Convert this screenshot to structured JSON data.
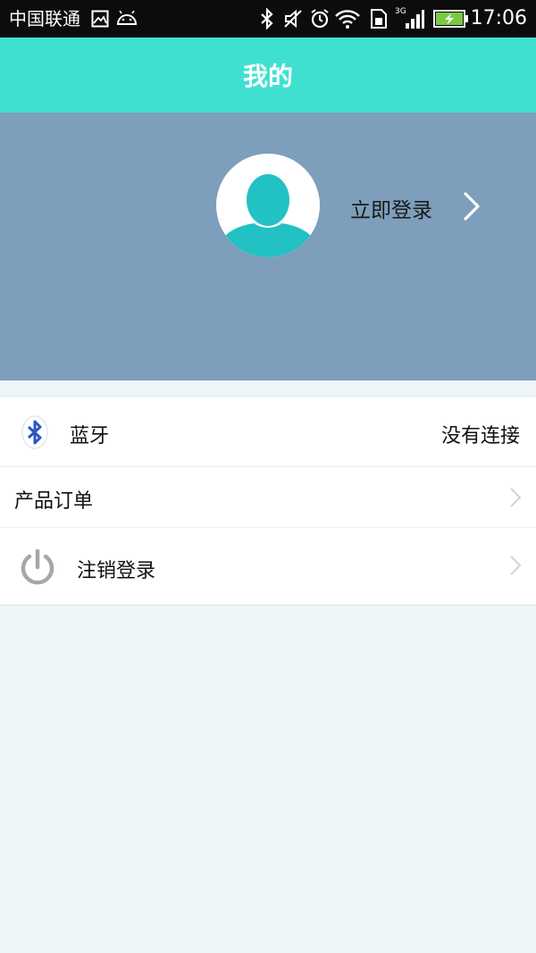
{
  "status_bar": {
    "carrier": "中国联通",
    "time": "17:06",
    "network_type": "3G",
    "icons": [
      "image-icon",
      "android-icon",
      "bluetooth-icon",
      "mute-icon",
      "alarm-icon",
      "wifi-icon",
      "sim-icon",
      "signal-icon",
      "battery-charging-icon"
    ]
  },
  "header": {
    "title": "我的"
  },
  "profile": {
    "login_label": "立即登录",
    "avatar_icon": "default-avatar-icon"
  },
  "menu": {
    "bluetooth": {
      "label": "蓝牙",
      "status": "没有连接",
      "icon": "bluetooth-icon"
    },
    "orders": {
      "label": "产品订单"
    },
    "logout": {
      "label": "注销登录",
      "icon": "power-icon"
    }
  },
  "colors": {
    "status_bar": "#0c0c0c",
    "header_bg": "#40e0d0",
    "profile_bg": "#7e9fbb",
    "avatar_fill": "#22c1c3",
    "page_bg": "#eef5f8",
    "bluetooth_blue": "#2a56c6"
  }
}
